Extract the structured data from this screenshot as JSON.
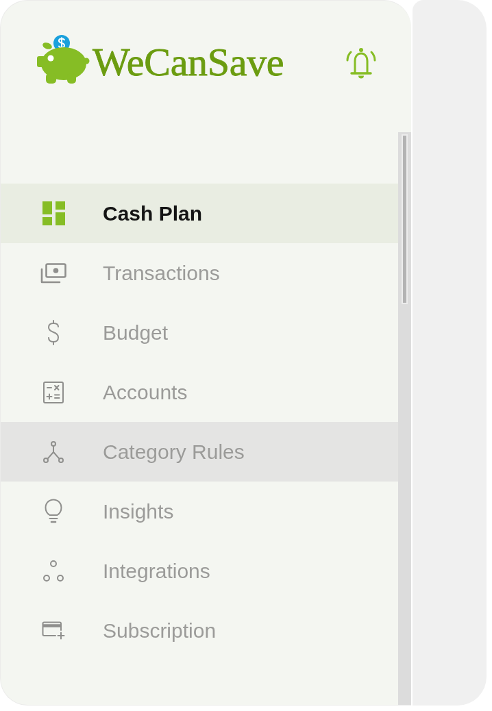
{
  "header": {
    "logo_text": "WeCanSave"
  },
  "nav": [
    {
      "label": "Cash Plan",
      "selected": true,
      "hovered": false
    },
    {
      "label": "Transactions",
      "selected": false,
      "hovered": false
    },
    {
      "label": "Budget",
      "selected": false,
      "hovered": false
    },
    {
      "label": "Accounts",
      "selected": false,
      "hovered": false
    },
    {
      "label": "Category Rules",
      "selected": false,
      "hovered": true
    },
    {
      "label": "Insights",
      "selected": false,
      "hovered": false
    },
    {
      "label": "Integrations",
      "selected": false,
      "hovered": false
    },
    {
      "label": "Subscription",
      "selected": false,
      "hovered": false
    }
  ]
}
